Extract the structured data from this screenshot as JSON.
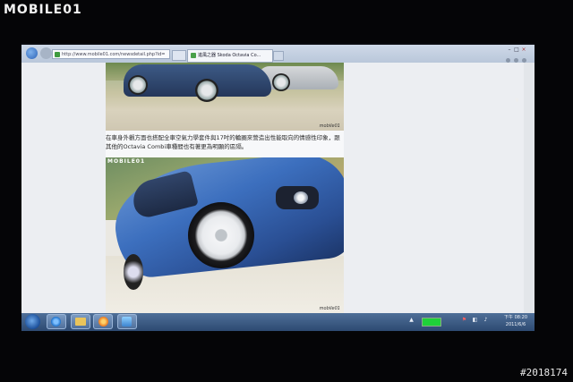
{
  "watermark": {
    "logo_text": "MOBILE",
    "logo_mark": "01",
    "image_number": "#2018174"
  },
  "browser": {
    "address_url": "http://www.mobile01.com/newsdetail.php?id=",
    "tab_title": "進風之器 Skoda Octavia Co...",
    "back_icon": "back-arrow-icon",
    "forward_icon": "forward-arrow-icon",
    "window_controls": [
      "–",
      "□",
      "×"
    ],
    "toolbar_icons": [
      "home-icon",
      "favorites-icon",
      "gear-icon"
    ]
  },
  "page": {
    "photo1_credit": "mobile01",
    "caption_line1": "在車身外觀方面也搭配全車空氣力學套件與17吋的輪圈來營造出性能取向的情感性印象，跟",
    "caption_line2": "其他的Octavia Combi車種間也有著更為明顯的區隔。",
    "photo2_watermark": "MOBILE01",
    "photo2_credit": "mobile01"
  },
  "taskbar": {
    "start_icon": "windows-start-icon",
    "pinned": [
      "internet-explorer-icon",
      "file-explorer-icon",
      "media-player-icon",
      "network-app-icon"
    ],
    "tray_glyphs": [
      "▲",
      "⚑",
      "◧",
      "♪"
    ],
    "clock_time": "下午 08:20",
    "clock_date": "2011/6/6"
  }
}
